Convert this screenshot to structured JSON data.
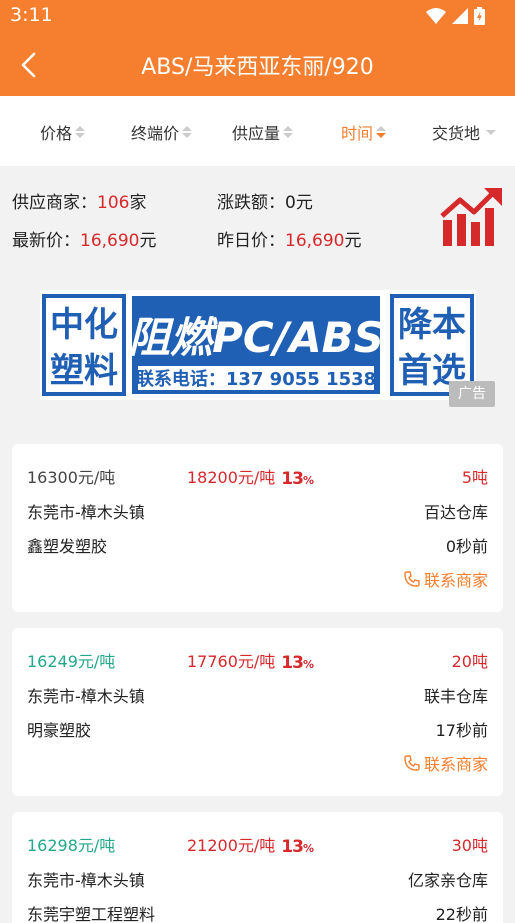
{
  "status": {
    "time": "3:11"
  },
  "header": {
    "title": "ABS/马来西亚东丽/920"
  },
  "filters": [
    {
      "label": "价格",
      "active": false
    },
    {
      "label": "终端价",
      "active": false
    },
    {
      "label": "供应量",
      "active": false
    },
    {
      "label": "时间",
      "active": true
    },
    {
      "label": "交货地",
      "active": false
    }
  ],
  "summary": {
    "supplier_label": "供应商家：",
    "supplier_count": "106",
    "supplier_unit": "家",
    "change_label": "涨跌额：",
    "change_value": "0元",
    "latest_label": "最新价：",
    "latest_value": "16,690",
    "latest_unit": "元",
    "yesterday_label": "昨日价：",
    "yesterday_value": "16,690",
    "yesterday_unit": "元"
  },
  "ad": {
    "left_top": "中化",
    "left_bottom": "塑料",
    "main": "阻燃PC/ABS",
    "phone": "联系电话：137 9055 1538",
    "right_top": "降本",
    "right_bottom": "首选",
    "tag": "广告"
  },
  "listings": [
    {
      "price": "16300元/吨",
      "terminal": "18200元/吨",
      "badge": "13",
      "badge_sup": "%",
      "qty": "5吨",
      "location": "东莞市-樟木头镇",
      "warehouse": "百达仓库",
      "company": "鑫塑发塑胶",
      "time": "0秒前",
      "contact": "联系商家"
    },
    {
      "price": "16249元/吨",
      "terminal": "17760元/吨",
      "badge": "13",
      "badge_sup": "%",
      "qty": "20吨",
      "location": "东莞市-樟木头镇",
      "warehouse": "联丰仓库",
      "company": "明豪塑胶",
      "time": "17秒前",
      "contact": "联系商家"
    },
    {
      "price": "16298元/吨",
      "terminal": "21200元/吨",
      "badge": "13",
      "badge_sup": "%",
      "qty": "30吨",
      "location": "东莞市-樟木头镇",
      "warehouse": "亿家亲仓库",
      "company": "东莞宇塑工程塑料",
      "time": "22秒前"
    }
  ],
  "colors": {
    "brand": "#f57f2f",
    "red": "#d6292c",
    "green": "#22a88a",
    "ad_blue": "#1f5fb4"
  }
}
